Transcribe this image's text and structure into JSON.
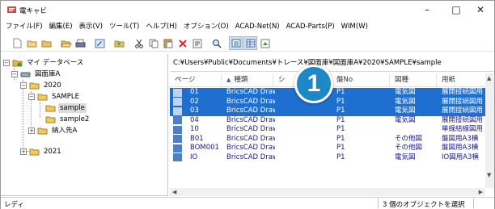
{
  "window": {
    "title": "電キャビ",
    "minimize": "–",
    "maximize": "□",
    "close": "✕"
  },
  "menu": [
    "ファイル(F)",
    "編集(E)",
    "表示(V)",
    "ツール(T)",
    "ヘルプ(H)",
    "オプション(O)",
    "ACAD-Net(N)",
    "ACAD-Parts(P)",
    "WIM(W)"
  ],
  "tree": {
    "root": "マイ データベース",
    "db": "図面庫A",
    "y2020": "2020",
    "sample": "SAMPLE",
    "sample_child": "sample",
    "sample2": "sample2",
    "nounyu": "納入先A",
    "y2021": "2021"
  },
  "path": "C:¥Users¥Public¥Documents¥トレース¥図面庫¥図面庫A¥2020¥SAMPLE¥sample",
  "columns": [
    "ページ",
    "種類",
    "シ",
    "盤No",
    "図種",
    "用紙"
  ],
  "rows": [
    {
      "page": "01",
      "type": "BricsCAD Draw",
      "ban": "P1",
      "zushu": "電気図",
      "yoshi": "展開接続図用",
      "selected": true
    },
    {
      "page": "02",
      "type": "BricsCAD Draw",
      "ban": "P1",
      "zushu": "電気図",
      "yoshi": "展開接続図用",
      "selected": true
    },
    {
      "page": "03",
      "type": "BricsCAD Draw",
      "ban": "P1",
      "zushu": "電気図",
      "yoshi": "展開接続図用",
      "selected": true
    },
    {
      "page": "04",
      "type": "BricsCAD Draw",
      "ban": "P1",
      "zushu": "電気図",
      "yoshi": "展開接続図用",
      "selected": false
    },
    {
      "page": "10",
      "type": "BricsCAD Draw",
      "ban": "P1",
      "zushu": "",
      "yoshi": "単線結線図用",
      "selected": false
    },
    {
      "page": "B01",
      "type": "BricsCAD Draw",
      "ban": "P1",
      "zushu": "その他図",
      "yoshi": "盤図用A3横",
      "selected": false
    },
    {
      "page": "BOM001",
      "type": "BricsCAD Draw",
      "ban": "P1",
      "zushu": "その他図",
      "yoshi": "盤図用A3横",
      "selected": false
    },
    {
      "page": "IO",
      "type": "BricsCAD Draw",
      "ban": "P1",
      "zushu": "電気図",
      "yoshi": "IO図用A3横",
      "selected": false
    }
  ],
  "status": {
    "left": "レディ",
    "right": "3 個のオブジェクトを選択"
  },
  "badge": "1",
  "colors": {
    "selection": "#1e6fcf",
    "badge": "#1e88c7",
    "link_text": "#1a1a8a"
  }
}
